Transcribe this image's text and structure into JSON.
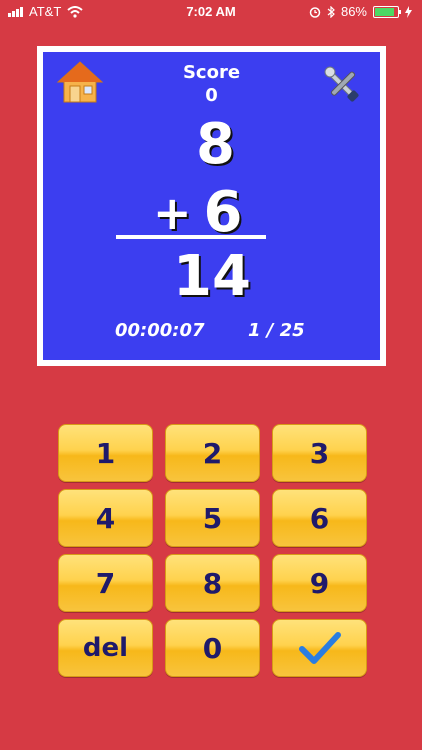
{
  "status_bar": {
    "carrier": "AT&T",
    "time": "7:02 AM",
    "battery": "86%"
  },
  "game": {
    "score_label": "Score",
    "score_value": "0",
    "top_number": "8",
    "operator": "+",
    "bottom_number": "6",
    "answer": "14",
    "timer": "00:00:07",
    "progress": "1 / 25"
  },
  "keypad": {
    "k1": "1",
    "k2": "2",
    "k3": "3",
    "k4": "4",
    "k5": "5",
    "k6": "6",
    "k7": "7",
    "k8": "8",
    "k9": "9",
    "del": "del",
    "k0": "0"
  },
  "colors": {
    "background": "#d63a44",
    "panel": "#3c3ef0",
    "key_text": "#1f1a6b",
    "check": "#2a7de1"
  }
}
